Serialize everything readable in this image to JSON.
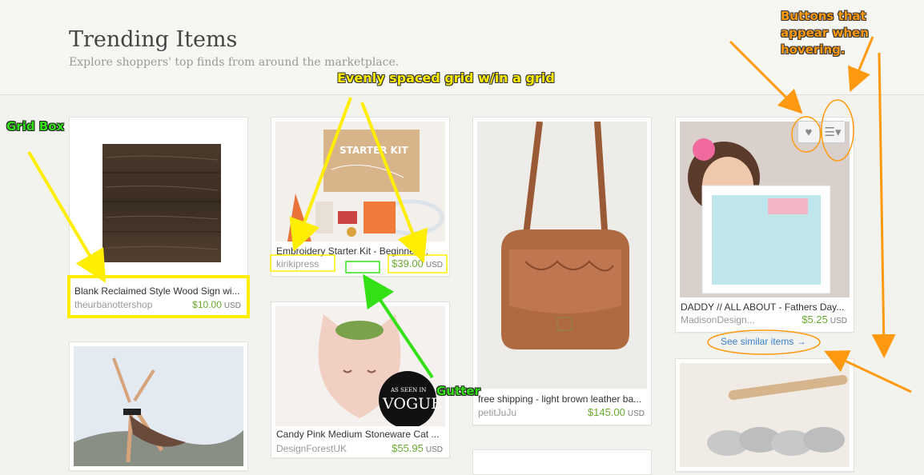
{
  "header": {
    "title": "Trending Items",
    "subtitle": "Explore shoppers' top finds from around the marketplace."
  },
  "items": [
    {
      "name": "Blank Reclaimed Style Wood Sign wi...",
      "shop": "theurbanottershop",
      "price": "$10.00",
      "currency": "USD"
    },
    {
      "name": "Embroidery Starter Kit - Beginner ...",
      "shop": "kirikipress",
      "price": "$39.00",
      "currency": "USD"
    },
    {
      "name": "free shipping - light brown leather ba...",
      "shop": "petitJuJu",
      "price": "$145.00",
      "currency": "USD"
    },
    {
      "name": "DADDY // ALL ABOUT - Fathers Day...",
      "shop": "MadisonDesign...",
      "price": "$5.25",
      "currency": "USD"
    },
    {
      "name": "Candy Pink Medium Stoneware Cat ...",
      "shop": "DesignForestUK",
      "price": "$55.95",
      "currency": "USD"
    }
  ],
  "kit_box_text": "STARTER KIT",
  "vogue_badge": {
    "top": "AS SEEN IN",
    "main": "VOGUE"
  },
  "see_similar": "See similar items →",
  "annotations": {
    "grid_box": "Grid Box",
    "evenly_spaced": "Evenly spaced grid w/in a grid",
    "gutter": "Gutter",
    "hover_buttons": "Buttons that appear when hovering."
  },
  "colors": {
    "price_green": "#6bab2f",
    "link_blue": "#3a7fcf",
    "annotation_yellow": "#ffee00",
    "annotation_green": "#33e015",
    "annotation_orange": "#ff9a10"
  },
  "icons": {
    "favorite": "heart-icon",
    "menu": "list-menu-icon"
  }
}
